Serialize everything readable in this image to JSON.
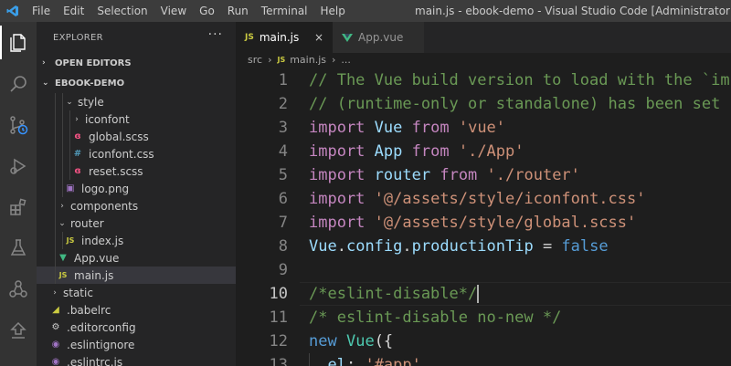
{
  "titlebar": {
    "menu": [
      "File",
      "Edit",
      "Selection",
      "View",
      "Go",
      "Run",
      "Terminal",
      "Help"
    ],
    "title": "main.js - ebook-demo - Visual Studio Code [Administrator]"
  },
  "activity_bar": [
    "explorer-icon",
    "search-icon",
    "source-control-icon",
    "run-debug-icon",
    "extensions-icon",
    "testing-icon",
    "remote-explorer-icon",
    "timeline-icon"
  ],
  "sidebar": {
    "header": "EXPLORER",
    "more": "···",
    "open_editors": "OPEN EDITORS",
    "project": "EBOOK-DEMO",
    "tree": [
      {
        "label": "style",
        "type": "folder-open",
        "depth": 2
      },
      {
        "label": "iconfont",
        "type": "folder-closed",
        "depth": 3
      },
      {
        "label": "global.scss",
        "type": "scss",
        "depth": 3
      },
      {
        "label": "iconfont.css",
        "type": "css",
        "depth": 3
      },
      {
        "label": "reset.scss",
        "type": "scss",
        "depth": 3
      },
      {
        "label": "logo.png",
        "type": "image",
        "depth": 2
      },
      {
        "label": "components",
        "type": "folder-closed",
        "depth": 1
      },
      {
        "label": "router",
        "type": "folder-open",
        "depth": 1
      },
      {
        "label": "index.js",
        "type": "js",
        "depth": 2
      },
      {
        "label": "App.vue",
        "type": "vue",
        "depth": 1
      },
      {
        "label": "main.js",
        "type": "js",
        "depth": 1,
        "selected": true
      },
      {
        "label": "static",
        "type": "folder-closed",
        "depth": 0
      },
      {
        "label": ".babelrc",
        "type": "babel",
        "depth": 0
      },
      {
        "label": ".editorconfig",
        "type": "config",
        "depth": 0
      },
      {
        "label": ".eslintignore",
        "type": "eslint",
        "depth": 0
      },
      {
        "label": ".eslintrc.js",
        "type": "eslint",
        "depth": 0
      }
    ]
  },
  "tabs": [
    {
      "label": "main.js",
      "icon": "JS",
      "active": true,
      "close": "×"
    },
    {
      "label": "App.vue",
      "icon": "vue",
      "active": false
    }
  ],
  "breadcrumb": {
    "folder": "src",
    "sep": "›",
    "file_icon": "JS",
    "file": "main.js",
    "symbol": "..."
  },
  "editor": {
    "current_line": 10,
    "lines": [
      {
        "n": "1",
        "tokens": [
          {
            "t": "// The Vue build version to load with the `im",
            "c": "comment"
          }
        ]
      },
      {
        "n": "2",
        "tokens": [
          {
            "t": "// (runtime-only or standalone) has been set",
            "c": "comment"
          }
        ]
      },
      {
        "n": "3",
        "tokens": [
          {
            "t": "import",
            "c": "kw"
          },
          {
            "t": " ",
            "c": "plain"
          },
          {
            "t": "Vue",
            "c": "id"
          },
          {
            "t": " ",
            "c": "plain"
          },
          {
            "t": "from",
            "c": "kw"
          },
          {
            "t": " ",
            "c": "plain"
          },
          {
            "t": "'vue'",
            "c": "str"
          }
        ]
      },
      {
        "n": "4",
        "tokens": [
          {
            "t": "import",
            "c": "kw"
          },
          {
            "t": " ",
            "c": "plain"
          },
          {
            "t": "App",
            "c": "id"
          },
          {
            "t": " ",
            "c": "plain"
          },
          {
            "t": "from",
            "c": "kw"
          },
          {
            "t": " ",
            "c": "plain"
          },
          {
            "t": "'./App'",
            "c": "str"
          }
        ]
      },
      {
        "n": "5",
        "tokens": [
          {
            "t": "import",
            "c": "kw"
          },
          {
            "t": " ",
            "c": "plain"
          },
          {
            "t": "router",
            "c": "id"
          },
          {
            "t": " ",
            "c": "plain"
          },
          {
            "t": "from",
            "c": "kw"
          },
          {
            "t": " ",
            "c": "plain"
          },
          {
            "t": "'./router'",
            "c": "str"
          }
        ]
      },
      {
        "n": "6",
        "tokens": [
          {
            "t": "import",
            "c": "kw"
          },
          {
            "t": " ",
            "c": "plain"
          },
          {
            "t": "'@/assets/style/iconfont.css'",
            "c": "str"
          }
        ]
      },
      {
        "n": "7",
        "tokens": [
          {
            "t": "import",
            "c": "kw"
          },
          {
            "t": " ",
            "c": "plain"
          },
          {
            "t": "'@/assets/style/global.scss'",
            "c": "str"
          }
        ]
      },
      {
        "n": "8",
        "tokens": [
          {
            "t": "Vue",
            "c": "id"
          },
          {
            "t": ".",
            "c": "plain"
          },
          {
            "t": "config",
            "c": "id"
          },
          {
            "t": ".",
            "c": "plain"
          },
          {
            "t": "productionTip",
            "c": "id"
          },
          {
            "t": " = ",
            "c": "plain"
          },
          {
            "t": "false",
            "c": "bool"
          }
        ]
      },
      {
        "n": "9",
        "tokens": []
      },
      {
        "n": "10",
        "tokens": [
          {
            "t": "/*eslint-disable*/",
            "c": "comment"
          }
        ]
      },
      {
        "n": "11",
        "tokens": [
          {
            "t": "/* eslint-disable no-new */",
            "c": "comment"
          }
        ]
      },
      {
        "n": "12",
        "tokens": [
          {
            "t": "new",
            "c": "bool"
          },
          {
            "t": " ",
            "c": "plain"
          },
          {
            "t": "Vue",
            "c": "class"
          },
          {
            "t": "({",
            "c": "plain"
          }
        ]
      },
      {
        "n": "13",
        "tokens": [
          {
            "t": "  ",
            "c": "plain"
          },
          {
            "t": "el",
            "c": "id"
          },
          {
            "t": ": ",
            "c": "plain"
          },
          {
            "t": "'#app'",
            "c": "str"
          },
          {
            "t": ",",
            "c": "plain"
          }
        ]
      }
    ]
  },
  "colors": {
    "titlebar": "#3c3c3c",
    "activitybar": "#333333",
    "sidebar": "#252526",
    "editor": "#1e1e1e",
    "comment": "#6a9955",
    "keyword": "#c586c0",
    "identifier": "#9cdcfe",
    "string": "#ce9178",
    "vue_green": "#41b883",
    "js_yellow": "#cbcb41"
  }
}
